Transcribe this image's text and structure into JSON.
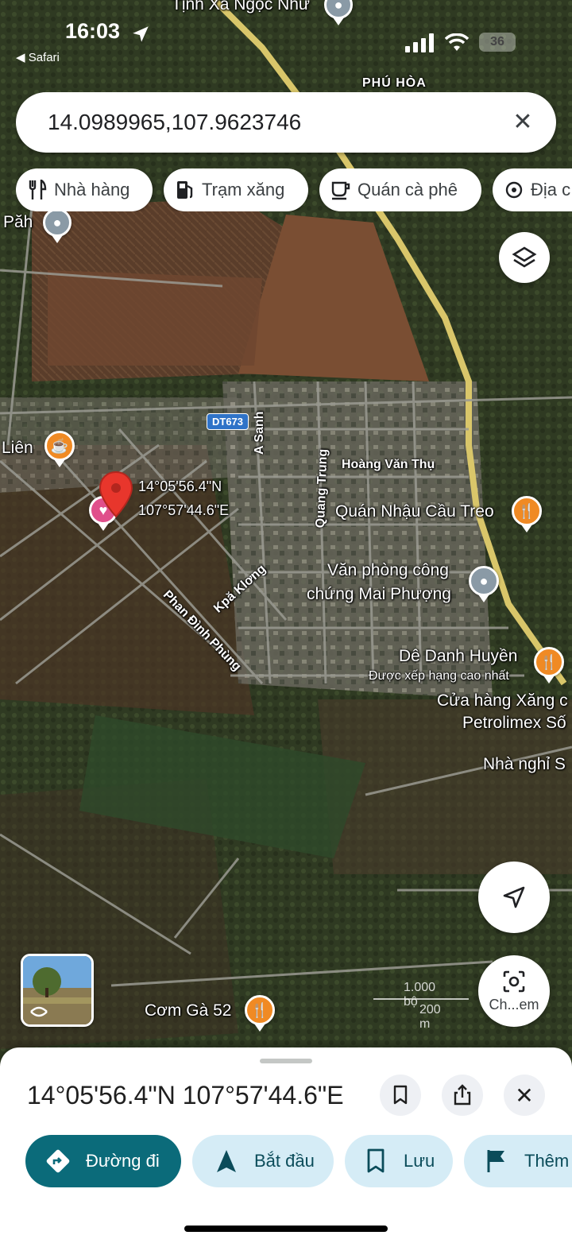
{
  "status_bar": {
    "time": "16:03",
    "back_app": "◀ Safari",
    "battery": "36"
  },
  "search": {
    "query": "14.0989965,107.9623746"
  },
  "chips": [
    {
      "label": "Nhà hàng",
      "icon": "fork-knife-icon"
    },
    {
      "label": "Trạm xăng",
      "icon": "gas-pump-icon"
    },
    {
      "label": "Quán cà phê",
      "icon": "coffee-cup-icon"
    },
    {
      "label": "Địa c",
      "icon": "landmark-icon"
    }
  ],
  "map": {
    "labels": {
      "tinh_xa": "Tịnh Xá Ngọc Như",
      "phu_hoa": "PHÚ HÒA",
      "pah": "Păh",
      "lien": "Liên",
      "road_badge": "DT673",
      "coord_lat": "14°05'56.4\"N",
      "coord_lng": "107°57'44.6\"E",
      "a_sanh": "A Sanh",
      "quang_trung": "Quang Trung",
      "hoang_van_thu": "Hoàng Văn Thụ",
      "quan_nhau": "Quán Nhậu Cầu Treo",
      "van_phong_1": "Văn phòng công",
      "van_phong_2": "chứng Mai Phượng",
      "kpa_klong": "Kpă Klơng",
      "phan_dinh_phung": "Phan Đình Phùng",
      "de_danh_huyen": "Dê Danh Huyền",
      "de_rating": "Được xếp hạng cao nhất",
      "cua_hang_1": "Cửa hàng Xăng c",
      "cua_hang_2": "Petrolimex Số",
      "nha_nghi": "Nhà nghỉ S",
      "com_ga": "Cơm Gà 52"
    },
    "scale": {
      "feet": "1.000 bộ",
      "meters": "200 m"
    },
    "lens_label": "Ch...em"
  },
  "sheet": {
    "title": "14°05'56.4\"N 107°57'44.6\"E",
    "actions": {
      "directions": "Đường đi",
      "start": "Bắt đầu",
      "save": "Lưu",
      "more": "Thêm"
    }
  },
  "colors": {
    "accent": "#0b6b7a",
    "tonal": "#d5ecf6",
    "poi_orange": "#f08a24",
    "pin_red": "#e8362c"
  }
}
